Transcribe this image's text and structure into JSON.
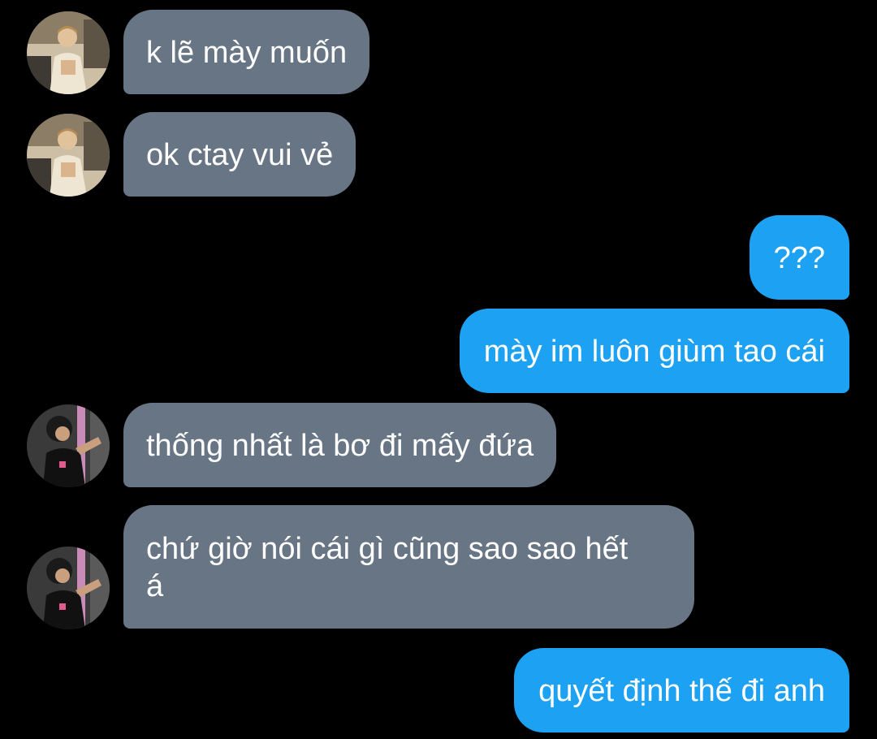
{
  "messages": [
    {
      "id": "m1",
      "direction": "incoming",
      "sender": "user-a",
      "text": "k lẽ mày muốn"
    },
    {
      "id": "m2",
      "direction": "incoming",
      "sender": "user-a",
      "text": "ok ctay vui vẻ"
    },
    {
      "id": "m3",
      "direction": "outgoing",
      "sender": "me",
      "text": "???"
    },
    {
      "id": "m4",
      "direction": "outgoing",
      "sender": "me",
      "text": "mày im luôn giùm tao cái"
    },
    {
      "id": "m5",
      "direction": "incoming",
      "sender": "user-b",
      "text": "thống nhất là bơ đi mấy đứa"
    },
    {
      "id": "m6",
      "direction": "incoming",
      "sender": "user-b",
      "text_line1": "chứ giờ nói cái gì cũng sao sao hết",
      "text_line2": "á"
    },
    {
      "id": "m7",
      "direction": "outgoing",
      "sender": "me",
      "text": "quyết định thế đi anh"
    }
  ],
  "colors": {
    "background": "#000000",
    "incoming_bubble": "#677585",
    "outgoing_bubble": "#1da1f2",
    "text": "#ffffff"
  }
}
